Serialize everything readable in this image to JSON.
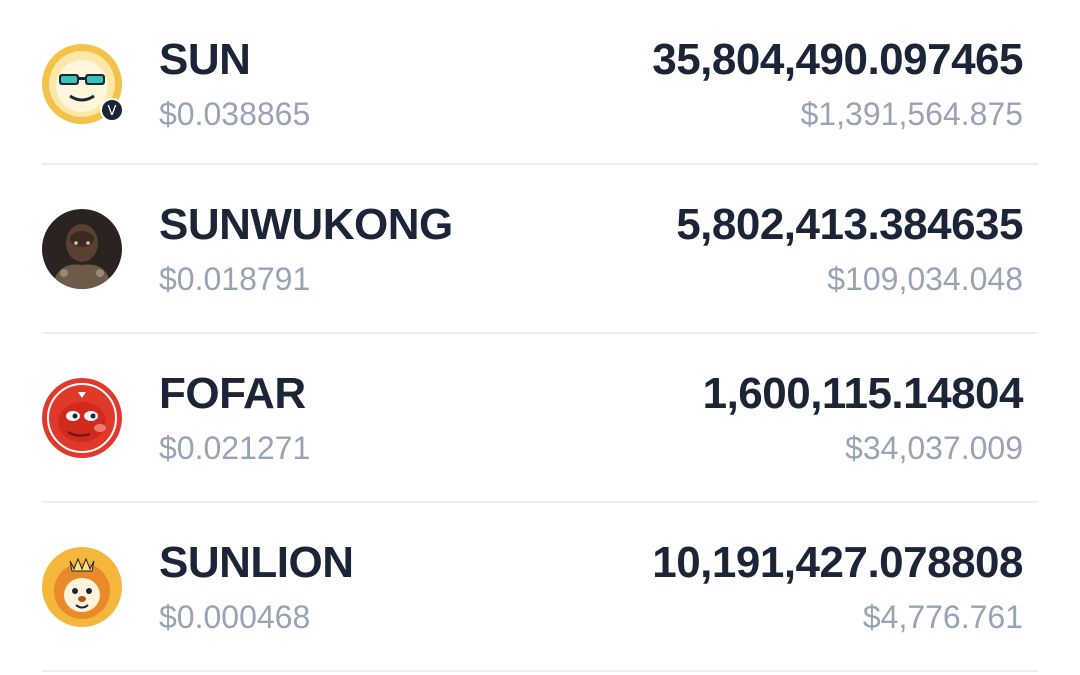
{
  "tokens": [
    {
      "name": "SUN",
      "price": "$0.038865",
      "amount": "35,804,490.097465",
      "value": "$1,391,564.875",
      "icon": "sun-token-icon",
      "verified": true
    },
    {
      "name": "SUNWUKONG",
      "price": "$0.018791",
      "amount": "5,802,413.384635",
      "value": "$109,034.048",
      "icon": "sunwukong-token-icon",
      "verified": false
    },
    {
      "name": "FOFAR",
      "price": "$0.021271",
      "amount": "1,600,115.14804",
      "value": "$34,037.009",
      "icon": "fofar-token-icon",
      "verified": false
    },
    {
      "name": "SUNLION",
      "price": "$0.000468",
      "amount": "10,191,427.078808",
      "value": "$4,776.761",
      "icon": "sunlion-token-icon",
      "verified": false
    }
  ],
  "verified_badge_letter": "V",
  "colors": {
    "primary_text": "#1c2437",
    "secondary_text": "#9aa3b5",
    "divider": "#eceef2"
  }
}
